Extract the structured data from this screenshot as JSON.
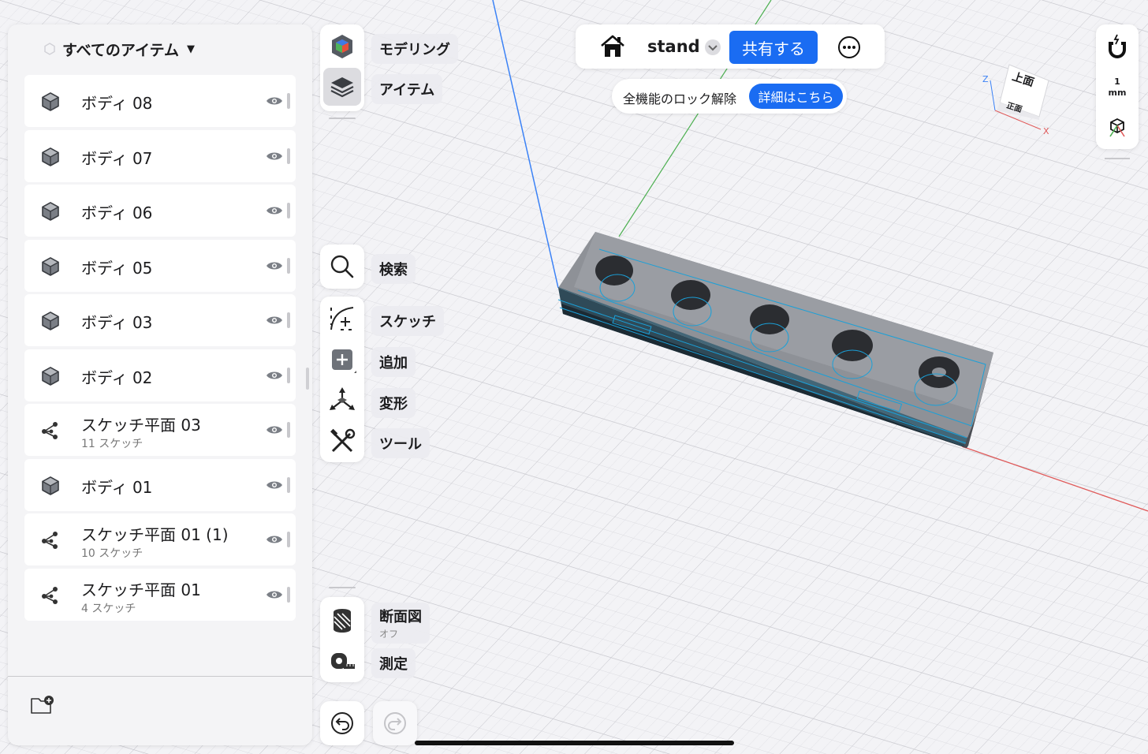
{
  "panel": {
    "header": "すべてのアイテム",
    "items": [
      {
        "type": "body",
        "label": "ボディ 08",
        "sub": ""
      },
      {
        "type": "body",
        "label": "ボディ 07",
        "sub": ""
      },
      {
        "type": "body",
        "label": "ボディ 06",
        "sub": ""
      },
      {
        "type": "body",
        "label": "ボディ 05",
        "sub": ""
      },
      {
        "type": "body",
        "label": "ボディ 03",
        "sub": ""
      },
      {
        "type": "body",
        "label": "ボディ 02",
        "sub": ""
      },
      {
        "type": "sketch",
        "label": "スケッチ平面 03",
        "sub": "11 スケッチ"
      },
      {
        "type": "body",
        "label": "ボディ 01",
        "sub": ""
      },
      {
        "type": "sketch",
        "label": "スケッチ平面 01 (1)",
        "sub": "10 スケッチ"
      },
      {
        "type": "sketch",
        "label": "スケッチ平面 01",
        "sub": "4 スケッチ"
      }
    ]
  },
  "tools": {
    "modeling": "モデリング",
    "items": "アイテム",
    "search": "検索",
    "sketch": "スケッチ",
    "add": "追加",
    "transform": "変形",
    "tool": "ツール",
    "section": "断面図",
    "section_state": "オフ",
    "measure": "測定"
  },
  "topbar": {
    "doc_name": "stand",
    "share": "共有する"
  },
  "unlock": {
    "text": "全機能のロック解除",
    "button": "詳細はこちら"
  },
  "viewcube": {
    "top": "上面",
    "front": "正面",
    "axis_z": "Z",
    "axis_x": "X"
  },
  "units": {
    "value": "1",
    "unit": "mm"
  },
  "colors": {
    "accent": "#1a6cf2",
    "axis_x": "#e05a5a",
    "axis_y": "#4caf50",
    "axis_z": "#3b82f6",
    "model": "#5a5f66",
    "selection": "#1aa0d8"
  }
}
